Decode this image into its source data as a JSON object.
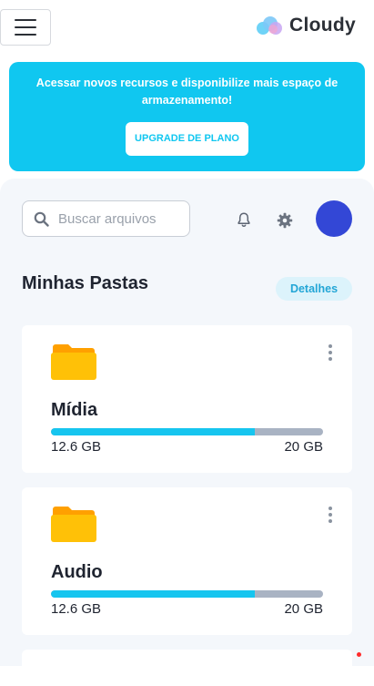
{
  "header": {
    "brand_name": "Cloudy",
    "menu_icon": "hamburger-icon",
    "logo_icon": "cloud-logo-icon"
  },
  "promo": {
    "text": "Acessar novos recursos e disponibilize mais espaço de armazenamento!",
    "button_label": "UPGRADE DE PLANO",
    "background_color": "#10c7f0"
  },
  "search": {
    "placeholder": "Buscar arquivos",
    "value": ""
  },
  "toolbar": {
    "notifications_icon": "bell-icon",
    "settings_icon": "gear-icon"
  },
  "folders_section": {
    "title": "Minhas Pastas",
    "details_label": "Detalhes"
  },
  "folders": [
    {
      "name": "Mídia",
      "used": "12.6 GB",
      "total": "20 GB",
      "usage_fraction": 0.75
    },
    {
      "name": "Audio",
      "used": "12.6 GB",
      "total": "20 GB",
      "usage_fraction": 0.75
    }
  ],
  "colors": {
    "accent": "#10c7f0",
    "avatar": "#3347d6",
    "folder": "#ffc107",
    "progress_track": "#a9b3c3"
  }
}
